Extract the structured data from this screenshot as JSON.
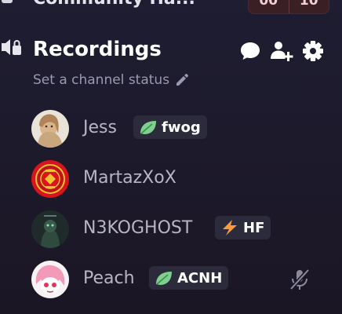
{
  "top_item": {
    "title": "Community Ha...",
    "counter_left": "00",
    "counter_right": "10"
  },
  "channel": {
    "name": "Recordings",
    "status_placeholder": "Set a channel status",
    "actions": [
      "chat-bubble-icon",
      "add-user-icon",
      "gear-icon"
    ]
  },
  "members": [
    {
      "name": "Jess",
      "tag": "fwog",
      "tag_icon": "leaf-icon",
      "muted": false
    },
    {
      "name": "MartazXoX",
      "tag": "",
      "muted": false
    },
    {
      "name": "N3KOGHOST",
      "tag": "HF",
      "tag_icon": "lightning-icon",
      "muted": false
    },
    {
      "name": "Peach",
      "tag": "ACNH",
      "tag_icon": "leaf-icon",
      "muted": true
    }
  ],
  "colors": {
    "background": "#1d1a2c",
    "leaf": "#7fd08e",
    "lightning": "#ff9a3c",
    "text_muted": "#9a9aae"
  }
}
